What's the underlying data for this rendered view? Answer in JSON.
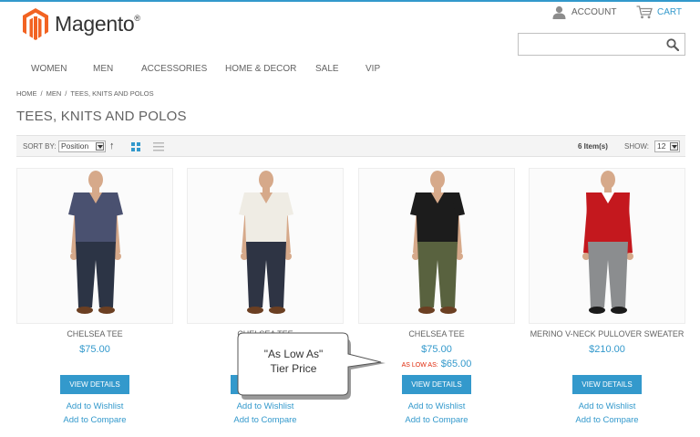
{
  "header": {
    "logo_text": "Magento",
    "logo_reg": "®",
    "account_label": "ACCOUNT",
    "cart_label": "CART",
    "search_placeholder": ""
  },
  "nav": {
    "items": [
      "WOMEN",
      "MEN",
      "ACCESSORIES",
      "HOME & DECOR",
      "SALE",
      "VIP"
    ]
  },
  "breadcrumb": [
    "HOME",
    "MEN",
    "TEES, KNITS AND POLOS"
  ],
  "breadcrumb_sep": "/",
  "page_title": "TEES, KNITS AND POLOS",
  "toolbar": {
    "sort_label": "SORT BY:",
    "sort_value": "Position",
    "direction_icon": "↑",
    "count": "6 Item(s)",
    "show_label": "SHOW:",
    "show_value": "12"
  },
  "products": [
    {
      "name": "CHELSEA TEE",
      "price": "$75.00",
      "as_low_as_label": "",
      "as_low_as_value": "",
      "shirt_color": "#4a5170",
      "pants_color": "#2c3445"
    },
    {
      "name": "CHELSEA TEE",
      "price": "",
      "as_low_as_label": "",
      "as_low_as_value": "",
      "shirt_color": "#efece4",
      "pants_color": "#2e3444"
    },
    {
      "name": "CHELSEA TEE",
      "price": "$75.00",
      "as_low_as_label": "AS LOW AS:",
      "as_low_as_value": "$65.00",
      "shirt_color": "#1c1c1c",
      "pants_color": "#59623f"
    },
    {
      "name": "MERINO V-NECK PULLOVER SWEATER",
      "price": "$210.00",
      "as_low_as_label": "",
      "as_low_as_value": "",
      "shirt_color": "#c4181e",
      "pants_color": "#8b8d8f"
    }
  ],
  "product_actions": {
    "details": "VIEW DETAILS",
    "wishlist": "Add to Wishlist",
    "compare": "Add to Compare"
  },
  "callout": {
    "line1": "\"As Low  As\"",
    "line2": "Tier Price"
  },
  "colors": {
    "accent": "#3399cc",
    "logo_orange": "#f26322",
    "sale_red": "#df280a"
  }
}
